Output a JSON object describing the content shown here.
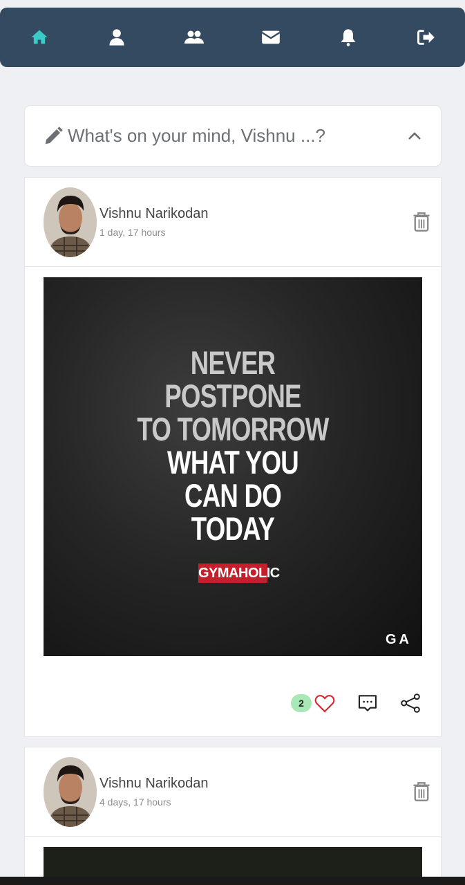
{
  "nav": {
    "items": [
      {
        "name": "home",
        "icon": "home-icon",
        "active": true
      },
      {
        "name": "profile",
        "icon": "user-icon"
      },
      {
        "name": "friends",
        "icon": "users-icon"
      },
      {
        "name": "messages",
        "icon": "envelope-icon"
      },
      {
        "name": "notifications",
        "icon": "bell-icon"
      },
      {
        "name": "logout",
        "icon": "sign-out-icon"
      }
    ],
    "active_color": "#3ec9c9",
    "bg_color": "#344a61"
  },
  "composer": {
    "prompt": "What's on your mind, Vishnu ...?"
  },
  "posts": [
    {
      "author": "Vishnu Narikodan",
      "time": "1 day, 17 hours",
      "image": {
        "lines": [
          "NEVER",
          "POSTPONE",
          "TO TOMORROW",
          "WHAT YOU",
          "CAN DO",
          "TODAY"
        ],
        "tag": "GYMAHOLIC",
        "mark": "GA"
      },
      "likes": "2"
    },
    {
      "author": "Vishnu Narikodan",
      "time": "4 days, 17 hours"
    }
  ]
}
